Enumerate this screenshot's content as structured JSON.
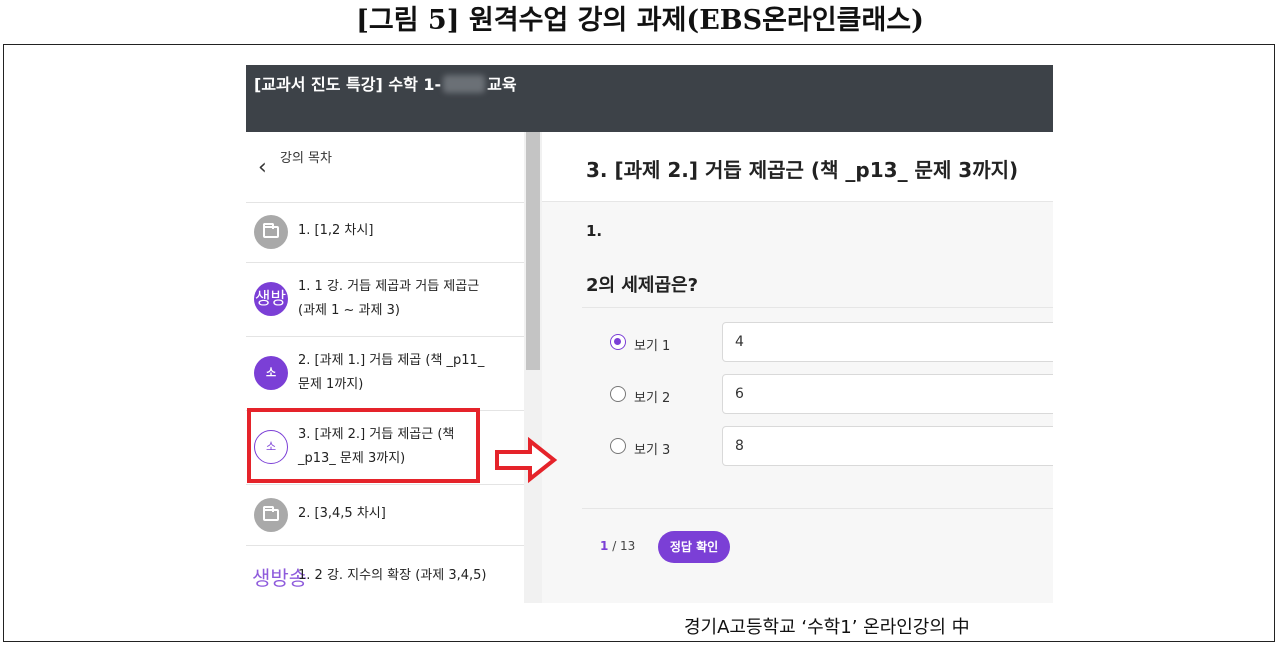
{
  "figure_title": "[그림 5] 원격수업 강의 과제(EBS온라인클래스)",
  "header": {
    "title_prefix": "[교과서 진도 특강] 수학 1-",
    "title_suffix": "교육"
  },
  "sidebar": {
    "back_label": "강의 목차",
    "items": [
      {
        "icon": "folder-icon",
        "icon_text": "",
        "line1": "1. [1,2 차시]",
        "line2": ""
      },
      {
        "icon": "live-icon",
        "icon_text": "생방",
        "line1": "1. 1 강. 거듭 제곱과 거듭 제곱근",
        "line2": "(과제 1 ~ 과제 3)"
      },
      {
        "icon": "small-lesson-icon",
        "icon_text": "소",
        "line1": "2. [과제 1.] 거듭 제곱 (책 _p11_",
        "line2": "문제 1까지)"
      },
      {
        "icon": "small-lesson-outline-icon",
        "icon_text": "소",
        "line1": "3. [과제 2.] 거듭 제곱근 (책",
        "line2": "_p13_ 문제 3까지)"
      },
      {
        "icon": "folder-icon",
        "icon_text": "",
        "line1": "2. [3,4,5 차시]",
        "line2": ""
      },
      {
        "icon": "live-icon",
        "icon_text": "생방송",
        "line1": "1. 2 강. 지수의 확장 (과제 3,4,5)",
        "line2": ""
      }
    ]
  },
  "main": {
    "lesson_title": "3. [과제 2.] 거듭 제곱근 (책 _p13_ 문제 3까지)",
    "question_number": "1.",
    "question_text": "2의 세제곱은?",
    "options": [
      {
        "label": "보기 1",
        "value": "4",
        "selected": true
      },
      {
        "label": "보기 2",
        "value": "6",
        "selected": false
      },
      {
        "label": "보기 3",
        "value": "8",
        "selected": false
      }
    ],
    "pager": {
      "current": "1",
      "total": "/ 13"
    },
    "check_button": "정답 확인"
  },
  "caption": "경기A고등학교 ‘수학1’ 온라인강의 中",
  "colors": {
    "accent": "#7b3fd6",
    "header_bg": "#3d4248",
    "highlight": "#e5232a"
  }
}
